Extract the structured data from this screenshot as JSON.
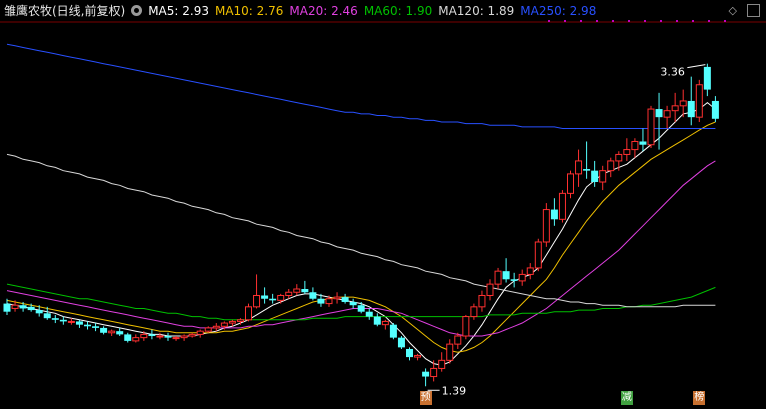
{
  "header": {
    "title": "雏鹰农牧(日线,前复权)",
    "ma": [
      {
        "label": "MA5: 2.93",
        "color": "#ffffff"
      },
      {
        "label": "MA10: 2.76",
        "color": "#f0c000"
      },
      {
        "label": "MA20: 2.46",
        "color": "#e040e0"
      },
      {
        "label": "MA60: 1.90",
        "color": "#00c000"
      },
      {
        "label": "MA120: 1.89",
        "color": "#d8d8d8"
      },
      {
        "label": "MA250: 2.98",
        "color": "#2850ff"
      }
    ]
  },
  "chart_data": {
    "type": "candlestick",
    "title": "雏鹰农牧(日线,前复权)",
    "annotations": [
      {
        "text": "3.36",
        "kind": "high"
      },
      {
        "text": "1.39",
        "kind": "low"
      }
    ],
    "markers": [
      {
        "text": "预",
        "bar": 52,
        "color": "#c87030"
      },
      {
        "text": "减",
        "bar": 77,
        "color": "#40a040"
      },
      {
        "text": "榜",
        "bar": 86,
        "color": "#c87030"
      }
    ],
    "ylim": [
      1.33,
      3.6
    ],
    "candles": [
      [
        1.9,
        1.93,
        1.83,
        1.85
      ],
      [
        1.87,
        1.92,
        1.85,
        1.89
      ],
      [
        1.89,
        1.91,
        1.85,
        1.87
      ],
      [
        1.88,
        1.9,
        1.85,
        1.86
      ],
      [
        1.86,
        1.89,
        1.82,
        1.84
      ],
      [
        1.84,
        1.88,
        1.8,
        1.81
      ],
      [
        1.81,
        1.83,
        1.78,
        1.8
      ],
      [
        1.8,
        1.82,
        1.77,
        1.79
      ],
      [
        1.79,
        1.81,
        1.77,
        1.79
      ],
      [
        1.79,
        1.8,
        1.75,
        1.77
      ],
      [
        1.77,
        1.79,
        1.74,
        1.76
      ],
      [
        1.76,
        1.78,
        1.73,
        1.75
      ],
      [
        1.75,
        1.76,
        1.71,
        1.72
      ],
      [
        1.72,
        1.74,
        1.7,
        1.73
      ],
      [
        1.73,
        1.75,
        1.7,
        1.71
      ],
      [
        1.71,
        1.72,
        1.66,
        1.67
      ],
      [
        1.67,
        1.71,
        1.66,
        1.69
      ],
      [
        1.69,
        1.73,
        1.67,
        1.71
      ],
      [
        1.71,
        1.74,
        1.68,
        1.7
      ],
      [
        1.7,
        1.72,
        1.68,
        1.7
      ],
      [
        1.7,
        1.72,
        1.67,
        1.69
      ],
      [
        1.69,
        1.7,
        1.67,
        1.69
      ],
      [
        1.69,
        1.71,
        1.67,
        1.7
      ],
      [
        1.7,
        1.72,
        1.69,
        1.71
      ],
      [
        1.71,
        1.74,
        1.69,
        1.73
      ],
      [
        1.73,
        1.76,
        1.72,
        1.75
      ],
      [
        1.75,
        1.78,
        1.73,
        1.76
      ],
      [
        1.76,
        1.79,
        1.74,
        1.78
      ],
      [
        1.78,
        1.8,
        1.76,
        1.79
      ],
      [
        1.79,
        1.81,
        1.77,
        1.8
      ],
      [
        1.8,
        1.9,
        1.79,
        1.88
      ],
      [
        1.88,
        2.08,
        1.87,
        1.95
      ],
      [
        1.95,
        2.0,
        1.9,
        1.93
      ],
      [
        1.93,
        1.96,
        1.9,
        1.92
      ],
      [
        1.92,
        1.96,
        1.9,
        1.95
      ],
      [
        1.95,
        1.99,
        1.93,
        1.97
      ],
      [
        1.97,
        2.02,
        1.95,
        1.99
      ],
      [
        1.99,
        2.04,
        1.96,
        1.97
      ],
      [
        1.97,
        2.0,
        1.92,
        1.93
      ],
      [
        1.93,
        1.96,
        1.88,
        1.9
      ],
      [
        1.9,
        1.95,
        1.88,
        1.93
      ],
      [
        1.93,
        1.97,
        1.9,
        1.94
      ],
      [
        1.94,
        1.96,
        1.9,
        1.91
      ],
      [
        1.91,
        1.93,
        1.87,
        1.89
      ],
      [
        1.89,
        1.91,
        1.84,
        1.85
      ],
      [
        1.85,
        1.87,
        1.8,
        1.82
      ],
      [
        1.82,
        1.84,
        1.76,
        1.77
      ],
      [
        1.77,
        1.8,
        1.74,
        1.79
      ],
      [
        1.77,
        1.78,
        1.68,
        1.69
      ],
      [
        1.69,
        1.7,
        1.62,
        1.63
      ],
      [
        1.62,
        1.63,
        1.55,
        1.57
      ],
      [
        1.57,
        1.59,
        1.55,
        1.58
      ],
      [
        1.48,
        1.5,
        1.39,
        1.45
      ],
      [
        1.45,
        1.55,
        1.42,
        1.5
      ],
      [
        1.5,
        1.6,
        1.48,
        1.55
      ],
      [
        1.55,
        1.68,
        1.53,
        1.65
      ],
      [
        1.65,
        1.72,
        1.62,
        1.7
      ],
      [
        1.7,
        1.83,
        1.68,
        1.82
      ],
      [
        1.82,
        1.9,
        1.8,
        1.88
      ],
      [
        1.88,
        1.98,
        1.85,
        1.95
      ],
      [
        1.95,
        2.05,
        1.92,
        2.02
      ],
      [
        2.02,
        2.12,
        1.99,
        2.1
      ],
      [
        2.1,
        2.18,
        2.03,
        2.05
      ],
      [
        2.05,
        2.09,
        2.0,
        2.04
      ],
      [
        2.04,
        2.11,
        2.01,
        2.08
      ],
      [
        2.08,
        2.15,
        2.05,
        2.12
      ],
      [
        2.12,
        2.3,
        2.1,
        2.28
      ],
      [
        2.28,
        2.52,
        2.25,
        2.48
      ],
      [
        2.48,
        2.55,
        2.38,
        2.42
      ],
      [
        2.42,
        2.6,
        2.4,
        2.58
      ],
      [
        2.58,
        2.72,
        2.55,
        2.7
      ],
      [
        2.7,
        2.85,
        2.62,
        2.78
      ],
      [
        2.73,
        2.9,
        2.67,
        2.72
      ],
      [
        2.72,
        2.78,
        2.62,
        2.65
      ],
      [
        2.65,
        2.75,
        2.6,
        2.72
      ],
      [
        2.72,
        2.8,
        2.68,
        2.78
      ],
      [
        2.78,
        2.84,
        2.72,
        2.82
      ],
      [
        2.82,
        2.92,
        2.78,
        2.85
      ],
      [
        2.85,
        2.92,
        2.8,
        2.9
      ],
      [
        2.9,
        2.98,
        2.84,
        2.88
      ],
      [
        2.88,
        3.12,
        2.86,
        3.1
      ],
      [
        3.1,
        3.2,
        2.85,
        3.05
      ],
      [
        3.05,
        3.12,
        2.98,
        3.09
      ],
      [
        3.09,
        3.2,
        3.02,
        3.12
      ],
      [
        3.12,
        3.22,
        3.05,
        3.15
      ],
      [
        3.15,
        3.3,
        3.0,
        3.05
      ],
      [
        3.05,
        3.28,
        3.02,
        3.25
      ],
      [
        3.36,
        3.38,
        3.18,
        3.22
      ],
      [
        3.15,
        3.18,
        3.02,
        3.04
      ]
    ],
    "ma_lines": {
      "MA5": [
        1.9,
        1.89,
        1.88,
        1.87,
        1.86,
        1.85,
        1.84,
        1.82,
        1.81,
        1.8,
        1.79,
        1.78,
        1.77,
        1.76,
        1.75,
        1.74,
        1.73,
        1.72,
        1.71,
        1.71,
        1.7,
        1.7,
        1.7,
        1.7,
        1.71,
        1.72,
        1.73,
        1.75,
        1.76,
        1.78,
        1.8,
        1.83,
        1.86,
        1.89,
        1.91,
        1.93,
        1.95,
        1.96,
        1.96,
        1.95,
        1.94,
        1.93,
        1.92,
        1.91,
        1.9,
        1.88,
        1.85,
        1.82,
        1.77,
        1.72,
        1.66,
        1.61,
        1.56,
        1.53,
        1.52,
        1.54,
        1.59,
        1.64,
        1.7,
        1.77,
        1.85,
        1.93,
        2.0,
        2.04,
        2.06,
        2.08,
        2.12,
        2.2,
        2.28,
        2.36,
        2.45,
        2.54,
        2.62,
        2.66,
        2.7,
        2.72,
        2.74,
        2.76,
        2.8,
        2.84,
        2.88,
        2.92,
        2.97,
        3.02,
        3.07,
        3.08,
        3.1,
        3.14,
        3.1
      ],
      "MA10": [
        1.92,
        1.91,
        1.9,
        1.89,
        1.88,
        1.87,
        1.86,
        1.85,
        1.84,
        1.83,
        1.82,
        1.81,
        1.8,
        1.79,
        1.78,
        1.77,
        1.76,
        1.75,
        1.74,
        1.73,
        1.73,
        1.72,
        1.72,
        1.72,
        1.72,
        1.72,
        1.72,
        1.73,
        1.73,
        1.74,
        1.75,
        1.77,
        1.79,
        1.81,
        1.83,
        1.85,
        1.87,
        1.89,
        1.91,
        1.92,
        1.93,
        1.94,
        1.94,
        1.94,
        1.93,
        1.92,
        1.9,
        1.88,
        1.85,
        1.82,
        1.78,
        1.74,
        1.7,
        1.66,
        1.63,
        1.61,
        1.6,
        1.61,
        1.63,
        1.66,
        1.7,
        1.75,
        1.8,
        1.85,
        1.9,
        1.95,
        2.0,
        2.05,
        2.12,
        2.2,
        2.27,
        2.34,
        2.41,
        2.47,
        2.53,
        2.58,
        2.63,
        2.67,
        2.71,
        2.75,
        2.79,
        2.82,
        2.85,
        2.88,
        2.91,
        2.94,
        2.97,
        3.0,
        3.02
      ],
      "MA20": [
        1.98,
        1.97,
        1.96,
        1.95,
        1.94,
        1.93,
        1.92,
        1.91,
        1.9,
        1.89,
        1.88,
        1.87,
        1.86,
        1.85,
        1.84,
        1.83,
        1.82,
        1.81,
        1.8,
        1.79,
        1.78,
        1.77,
        1.76,
        1.76,
        1.75,
        1.75,
        1.75,
        1.75,
        1.75,
        1.75,
        1.76,
        1.76,
        1.77,
        1.77,
        1.78,
        1.79,
        1.8,
        1.81,
        1.82,
        1.83,
        1.84,
        1.85,
        1.86,
        1.87,
        1.87,
        1.87,
        1.87,
        1.86,
        1.85,
        1.84,
        1.82,
        1.8,
        1.78,
        1.76,
        1.74,
        1.72,
        1.71,
        1.7,
        1.7,
        1.7,
        1.71,
        1.72,
        1.74,
        1.76,
        1.78,
        1.81,
        1.84,
        1.87,
        1.91,
        1.95,
        1.99,
        2.03,
        2.07,
        2.11,
        2.15,
        2.19,
        2.23,
        2.28,
        2.33,
        2.38,
        2.43,
        2.48,
        2.53,
        2.58,
        2.63,
        2.67,
        2.71,
        2.75,
        2.78
      ],
      "MA60": [
        2.02,
        2.01,
        2.0,
        1.99,
        1.98,
        1.97,
        1.96,
        1.95,
        1.94,
        1.93,
        1.93,
        1.92,
        1.91,
        1.9,
        1.89,
        1.88,
        1.87,
        1.87,
        1.86,
        1.85,
        1.84,
        1.84,
        1.83,
        1.82,
        1.82,
        1.81,
        1.81,
        1.8,
        1.8,
        1.8,
        1.8,
        1.8,
        1.8,
        1.8,
        1.8,
        1.8,
        1.8,
        1.8,
        1.81,
        1.81,
        1.81,
        1.81,
        1.82,
        1.82,
        1.82,
        1.82,
        1.82,
        1.82,
        1.82,
        1.82,
        1.82,
        1.82,
        1.82,
        1.82,
        1.82,
        1.82,
        1.82,
        1.82,
        1.82,
        1.82,
        1.83,
        1.83,
        1.83,
        1.83,
        1.84,
        1.84,
        1.84,
        1.84,
        1.85,
        1.85,
        1.85,
        1.86,
        1.86,
        1.86,
        1.87,
        1.87,
        1.87,
        1.88,
        1.88,
        1.89,
        1.89,
        1.9,
        1.91,
        1.92,
        1.93,
        1.94,
        1.96,
        1.98,
        2.0
      ],
      "MA120": [
        2.82,
        2.81,
        2.79,
        2.78,
        2.77,
        2.75,
        2.74,
        2.72,
        2.71,
        2.7,
        2.68,
        2.67,
        2.66,
        2.64,
        2.63,
        2.61,
        2.6,
        2.59,
        2.57,
        2.56,
        2.55,
        2.53,
        2.52,
        2.5,
        2.49,
        2.48,
        2.46,
        2.45,
        2.43,
        2.42,
        2.41,
        2.39,
        2.38,
        2.37,
        2.35,
        2.34,
        2.32,
        2.31,
        2.3,
        2.28,
        2.27,
        2.25,
        2.24,
        2.23,
        2.21,
        2.2,
        2.19,
        2.17,
        2.16,
        2.14,
        2.13,
        2.12,
        2.1,
        2.09,
        2.08,
        2.06,
        2.05,
        2.04,
        2.02,
        2.01,
        2.0,
        1.99,
        1.98,
        1.97,
        1.96,
        1.95,
        1.94,
        1.93,
        1.93,
        1.92,
        1.91,
        1.91,
        1.9,
        1.9,
        1.89,
        1.89,
        1.89,
        1.88,
        1.88,
        1.88,
        1.88,
        1.88,
        1.88,
        1.88,
        1.89,
        1.89,
        1.89,
        1.89,
        1.89
      ],
      "MA250": [
        3.5,
        3.49,
        3.48,
        3.47,
        3.46,
        3.45,
        3.44,
        3.43,
        3.42,
        3.41,
        3.4,
        3.39,
        3.38,
        3.37,
        3.36,
        3.35,
        3.34,
        3.33,
        3.32,
        3.31,
        3.3,
        3.29,
        3.28,
        3.27,
        3.26,
        3.25,
        3.24,
        3.23,
        3.22,
        3.21,
        3.2,
        3.19,
        3.18,
        3.17,
        3.16,
        3.15,
        3.14,
        3.13,
        3.12,
        3.11,
        3.1,
        3.09,
        3.08,
        3.08,
        3.07,
        3.07,
        3.06,
        3.06,
        3.05,
        3.05,
        3.04,
        3.04,
        3.03,
        3.03,
        3.02,
        3.02,
        3.02,
        3.01,
        3.01,
        3.01,
        3.0,
        3.0,
        3.0,
        3.0,
        2.99,
        2.99,
        2.99,
        2.99,
        2.99,
        2.98,
        2.98,
        2.98,
        2.98,
        2.98,
        2.98,
        2.98,
        2.98,
        2.98,
        2.98,
        2.98,
        2.98,
        2.98,
        2.98,
        2.98,
        2.98,
        2.98,
        2.98,
        2.98,
        2.98
      ]
    },
    "colors": {
      "up": "#ff3030",
      "down": "#54ffff",
      "background": "#000000",
      "grid": "#7a0000",
      "guide": "#c000c0"
    }
  }
}
